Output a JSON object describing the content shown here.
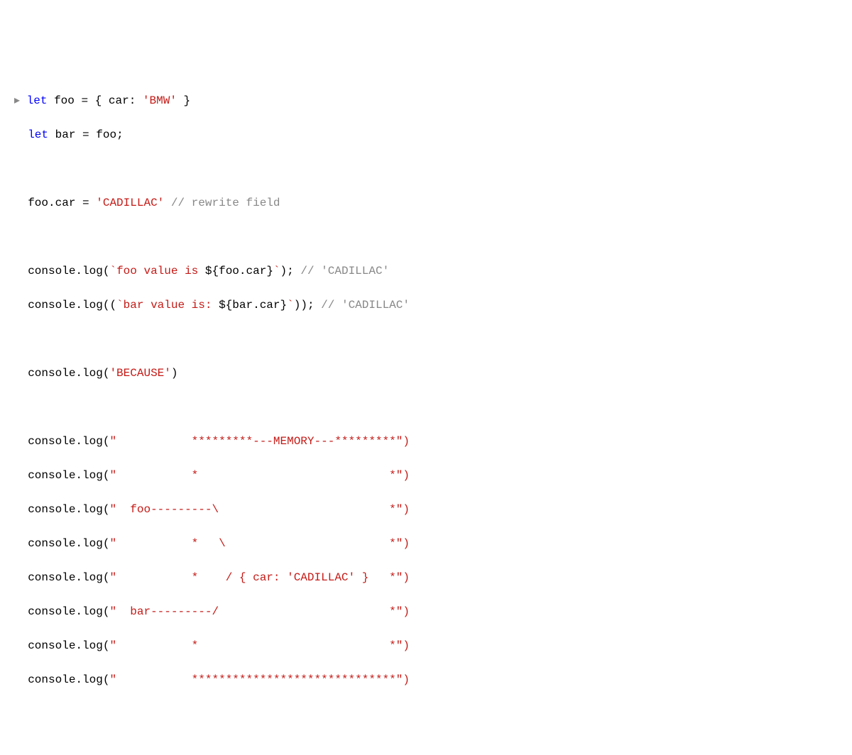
{
  "prompt": "▸ ",
  "line1": {
    "let": "let",
    "foo": "foo",
    "eq": " = ",
    "brace_open": "{ ",
    "car": "car",
    "colon": ": ",
    "bmw": "'BMW'",
    "brace_close": " }"
  },
  "line2": {
    "indent": "  ",
    "let": "let",
    "bar": "bar",
    "eq": " = ",
    "foo": "foo",
    "semi": ";"
  },
  "line4": {
    "indent": "  ",
    "foo": "foo",
    "dot": ".",
    "car": "car",
    "eq": " = ",
    "cadillac": "'CADILLAC'",
    "space": " ",
    "comment": "// rewrite field"
  },
  "line6": {
    "indent": "  ",
    "obj": "console",
    "dot": ".",
    "method": "log",
    "open": "(",
    "tick1": "`",
    "text": "foo value is ",
    "expr_open": "${",
    "foo": "foo",
    "edot": ".",
    "car": "car",
    "expr_close": "}",
    "tick2": "`",
    "close": ");",
    "space": " ",
    "comment": "// 'CADILLAC'"
  },
  "line7": {
    "indent": "  ",
    "obj": "console",
    "dot": ".",
    "method": "log",
    "open": "((",
    "tick1": "`",
    "text": "bar value is: ",
    "expr_open": "${",
    "bar": "bar",
    "edot": ".",
    "car": "car",
    "expr_close": "}",
    "tick2": "`",
    "close": "));",
    "space": " ",
    "comment": "// 'CADILLAC'"
  },
  "line9": {
    "indent": "  ",
    "obj": "console",
    "dot": ".",
    "method": "log",
    "open": "(",
    "because": "'BECAUSE'",
    "close": ")"
  },
  "ascii": {
    "prefix_indent": "  ",
    "obj": "console",
    "dot": ".",
    "method": "log",
    "open": "(",
    "quote": "\"",
    "close": "\")",
    "l1": "           *********---MEMORY---*********",
    "l2": "           *                            *",
    "l3": "  foo---------\\                         *",
    "l4": "           *   \\                        *",
    "l5": "           *    / { car: 'CADILLAC' }   *",
    "l6": "  bar---------/                         *",
    "l7": "           *                            *",
    "l8": "           ******************************"
  }
}
